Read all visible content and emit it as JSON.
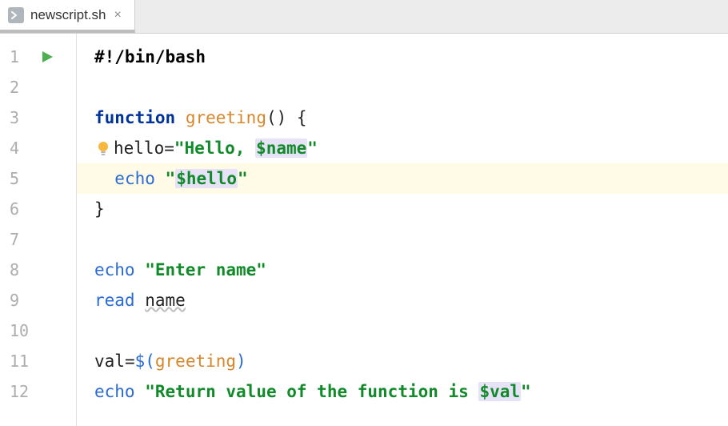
{
  "tab": {
    "filename": "newscript.sh",
    "close_glyph": "×"
  },
  "gutter": {
    "lines": [
      "1",
      "2",
      "3",
      "4",
      "5",
      "6",
      "7",
      "8",
      "9",
      "10",
      "11",
      "12"
    ],
    "run_on_line": 1
  },
  "editor": {
    "highlighted_line": 5
  },
  "code": {
    "l1": {
      "shebang": "#!/bin/bash"
    },
    "l3": {
      "kw": "function",
      "sp": " ",
      "fn": "greeting",
      "rest": "() {"
    },
    "l4": {
      "assign_left": "hello",
      "eq": "=",
      "str_open": "\"",
      "str_a": "Hello, ",
      "var": "$name",
      "str_close": "\""
    },
    "l5": {
      "indent": "  ",
      "echo": "echo",
      "sp": " ",
      "str_open": "\"",
      "var": "$hello",
      "str_close": "\""
    },
    "l6": {
      "brace": "}"
    },
    "l8": {
      "echo": "echo",
      "sp": " ",
      "str": "\"Enter name\""
    },
    "l9": {
      "read": "read",
      "sp": " ",
      "name": "name"
    },
    "l11": {
      "lhs": "val",
      "eq": "=",
      "sub_open": "$(",
      "call": "greeting",
      "sub_close": ")"
    },
    "l12": {
      "echo": "echo",
      "sp": " ",
      "str_open": "\"",
      "str_a": "Return value of the function is ",
      "var": "$val",
      "str_close": "\""
    }
  },
  "icons": {
    "run": "run-icon",
    "bulb": "intention-bulb-icon",
    "file": "shell-file-icon",
    "close": "close-icon"
  }
}
